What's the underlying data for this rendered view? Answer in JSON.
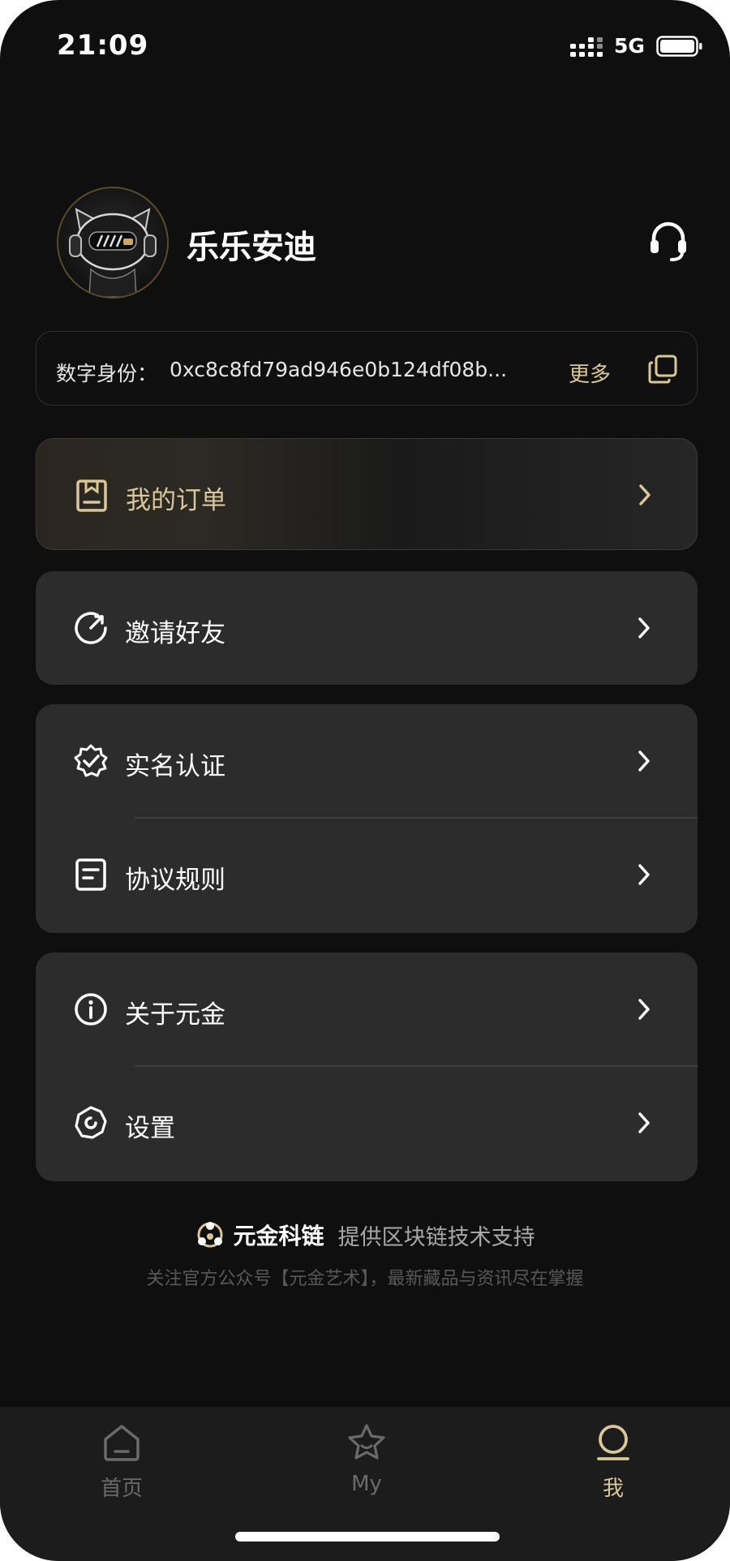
{
  "status_bar": {
    "time": "21:09",
    "network": "5G"
  },
  "profile": {
    "username": "乐乐安迪",
    "avatar": "robot-cat-avatar"
  },
  "identity": {
    "label": "数字身份：",
    "value": "0xc8c8fd79ad946e0b124df08b...",
    "more_label": "更多"
  },
  "menu": {
    "orders": {
      "label": "我的订单",
      "icon": "order-icon"
    },
    "invite": {
      "label": "邀请好友",
      "icon": "invite-icon"
    },
    "verify": {
      "label": "实名认证",
      "icon": "verified-badge-icon"
    },
    "agreement": {
      "label": "协议规则",
      "icon": "document-icon"
    },
    "about": {
      "label": "关于元金",
      "icon": "info-icon"
    },
    "settings": {
      "label": "设置",
      "icon": "settings-icon"
    }
  },
  "footer": {
    "brand": "元金科链",
    "support": "提供区块链技术支持",
    "follow": "关注官方公众号【元金艺术】，最新藏品与资讯尽在掌握"
  },
  "tabs": [
    {
      "label": "首页",
      "icon": "home-icon",
      "active": false
    },
    {
      "label": "My",
      "icon": "star-icon",
      "active": false
    },
    {
      "label": "我",
      "icon": "profile-icon",
      "active": true
    }
  ],
  "colors": {
    "background": "#0f0f0f",
    "card": "#2c2c2c",
    "accent_gold": "#d9c79a",
    "tab_inactive": "#6a6a6a"
  }
}
